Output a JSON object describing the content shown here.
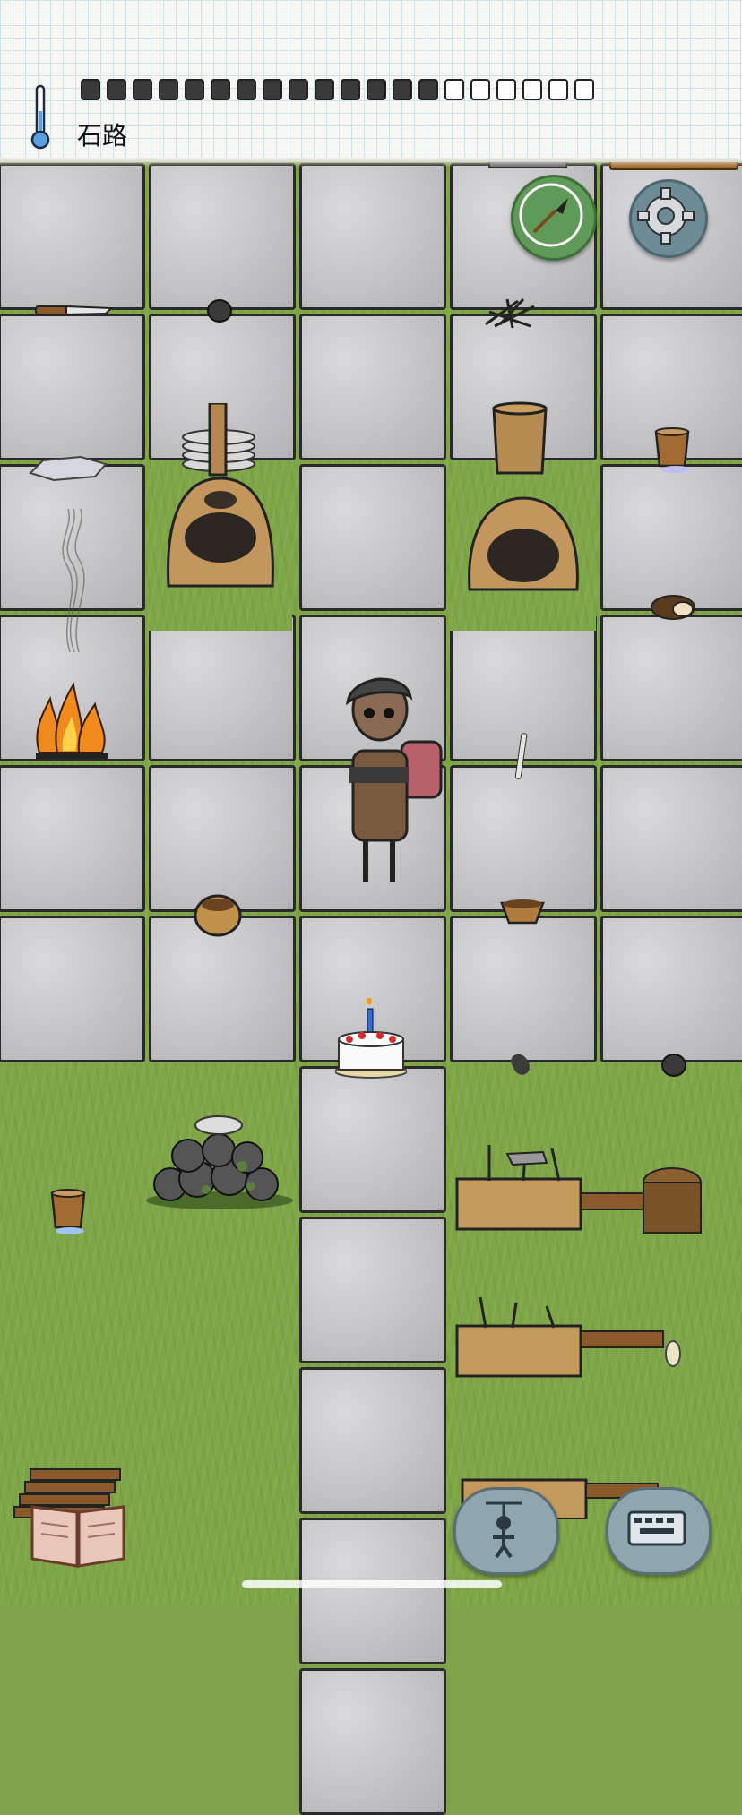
{
  "hud": {
    "location_label": "石路",
    "hunger_pips": [
      1,
      1,
      1,
      1,
      1,
      1,
      1,
      1,
      1,
      1,
      1,
      1,
      1,
      1,
      0,
      0,
      0,
      0,
      0,
      0
    ],
    "thermometer_icon": "thermometer-icon"
  },
  "controls": {
    "compass_icon": "compass-icon",
    "settings_icon": "gear-icon",
    "book_icon": "recipe-book-icon",
    "emote_icon": "puppet-emote-icon",
    "keyboard_icon": "keyboard-icon"
  },
  "items": {
    "cake_candle": "birthday-cake",
    "campfire": "campfire",
    "character": "player-character"
  }
}
